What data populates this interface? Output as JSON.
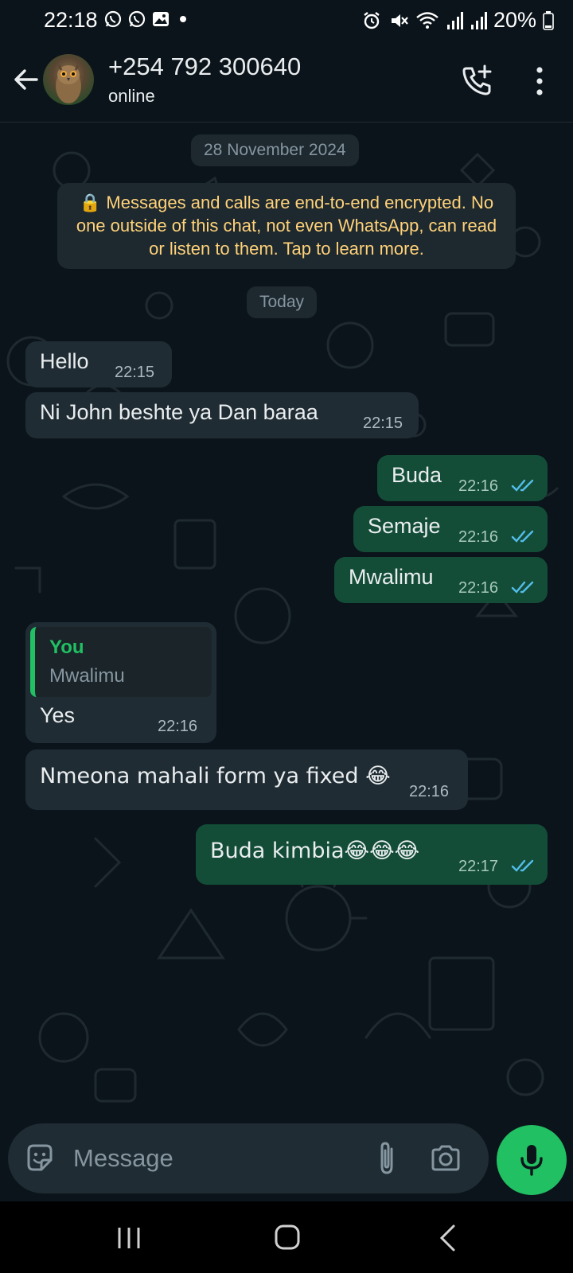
{
  "status_bar": {
    "time": "22:18",
    "battery": "20%",
    "left_icons": [
      "whatsapp-icon",
      "whatsapp-icon",
      "gallery-icon",
      "dot-icon"
    ],
    "right_icons": [
      "alarm-icon",
      "mute-icon",
      "wifi-icon",
      "signal-icon",
      "signal-icon",
      "battery-icon"
    ]
  },
  "header": {
    "contact_name": "+254 792 300640",
    "status": "online"
  },
  "chat": {
    "date_chip": "28 November 2024",
    "encryption_notice": "🔒 Messages and calls are end-to-end encrypted. No one outside of this chat, not even WhatsApp, can read or listen to them. Tap to learn more.",
    "today_chip": "Today",
    "messages": [
      {
        "direction": "in",
        "text": "Hello",
        "time": "22:15"
      },
      {
        "direction": "in",
        "text": "Ni John beshte ya Dan baraa",
        "time": "22:15"
      },
      {
        "direction": "out",
        "text": "Buda",
        "time": "22:16",
        "status": "read"
      },
      {
        "direction": "out",
        "text": "Semaje",
        "time": "22:16",
        "status": "read"
      },
      {
        "direction": "out",
        "text": "Mwalimu",
        "time": "22:16",
        "status": "read"
      },
      {
        "direction": "in",
        "text": "Yes",
        "time": "22:16",
        "quote": {
          "author": "You",
          "text": "Mwalimu"
        }
      },
      {
        "direction": "in",
        "text": "Nmeona mahali form ya fixed 😂",
        "time": "22:16"
      },
      {
        "direction": "out",
        "text": "Buda kimbia😂😂😂",
        "time": "22:17",
        "status": "read"
      }
    ]
  },
  "composer": {
    "placeholder": "Message"
  },
  "colors": {
    "background": "#0b141a",
    "incoming_bubble": "#202c33",
    "outgoing_bubble": "#134d37",
    "accent": "#21c063",
    "read_ticks": "#53bdeb",
    "encryption_text": "#ffd279"
  }
}
